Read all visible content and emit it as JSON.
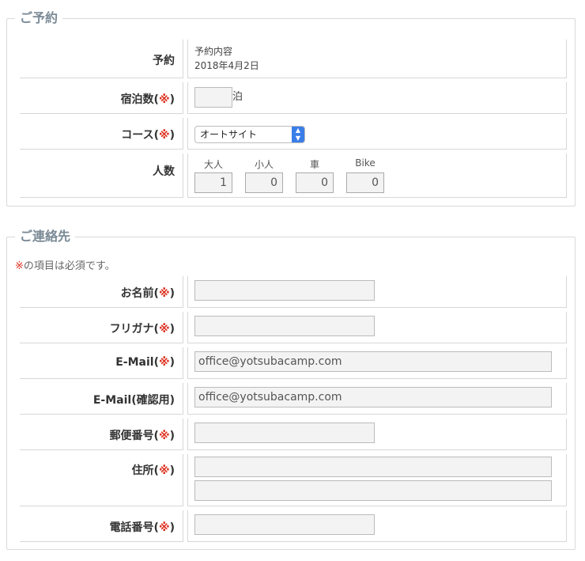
{
  "reservation": {
    "legend": "ご予約",
    "rows": {
      "booking": {
        "label": "予約",
        "line1": "予約内容",
        "line2": "2018年4月2日"
      },
      "nights": {
        "label": "宿泊数(",
        "required": "※",
        "close": ")",
        "value": "",
        "unit": "泊"
      },
      "course": {
        "label": "コース(",
        "required": "※",
        "close": ")",
        "selected": "オートサイト"
      },
      "people": {
        "label": "人数",
        "counters": [
          {
            "label": "大人",
            "value": "1"
          },
          {
            "label": "小人",
            "value": "0"
          },
          {
            "label": "車",
            "value": "0"
          },
          {
            "label": "Bike",
            "value": "0"
          }
        ]
      }
    }
  },
  "contact": {
    "legend": "ご連絡先",
    "note_mark": "※",
    "note_text": "の項目は必須です。",
    "rows": {
      "name": {
        "label": "お名前(",
        "required": "※",
        "close": ")",
        "value": ""
      },
      "furigana": {
        "label": "フリガナ(",
        "required": "※",
        "close": ")",
        "value": ""
      },
      "email": {
        "label": "E-Mail(",
        "required": "※",
        "close": ")",
        "value": "office@yotsubacamp.com"
      },
      "email_confirm": {
        "label": "E-Mail(確認用)",
        "value": "office@yotsubacamp.com"
      },
      "postal": {
        "label": "郵便番号(",
        "required": "※",
        "close": ")",
        "value": ""
      },
      "address": {
        "label": "住所(",
        "required": "※",
        "close": ")",
        "value1": "",
        "value2": ""
      },
      "phone": {
        "label": "電話番号(",
        "required": "※",
        "close": ")",
        "value": ""
      }
    }
  }
}
